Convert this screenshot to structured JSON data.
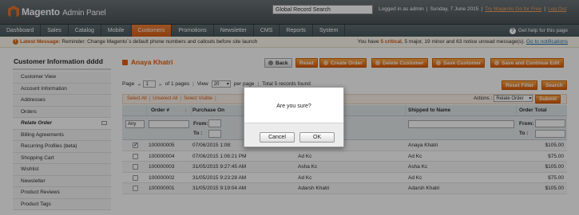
{
  "header": {
    "logo_text": "Magento",
    "logo_sub": "Admin Panel",
    "search_value": "Global Record Search",
    "logged_in": "Logged in as admin",
    "date": "Sunday, 7 June 2015",
    "try_link": "Try Magento Go for Free",
    "logout": "Log Out"
  },
  "nav": {
    "items": [
      "Dashboard",
      "Sales",
      "Catalog",
      "Mobile",
      "Customers",
      "Promotions",
      "Newsletter",
      "CMS",
      "Reports",
      "System"
    ],
    "help": "Get help for this page"
  },
  "message": {
    "label": "Latest Message:",
    "text": "Reminder: Change Magento`s default phone numbers and callouts before site launch",
    "right_prefix": "You have",
    "critical": "5 critical",
    "rest": ", 5 major, 19 minor and 63 notice unread message(s).",
    "link": "Go to notifications"
  },
  "sidebar": {
    "title": "Customer Information dddd",
    "items": [
      "Customer View",
      "Account Information",
      "Addresses",
      "Orders",
      "Relate Order",
      "Billing Agreements",
      "Recurring Profiles (beta)",
      "Shopping Cart",
      "Wishlist",
      "Newsletter",
      "Product Reviews",
      "Product Tags"
    ]
  },
  "main": {
    "title": "Anaya Khatri",
    "buttons": {
      "back": "Back",
      "reset": "Reset",
      "create_order": "Create Order",
      "delete_customer": "Delete Customer",
      "save_customer": "Save Customer",
      "save_continue": "Save and Continue Edit"
    }
  },
  "pager": {
    "page_label": "Page",
    "page_value": "1",
    "of_pages": "of 1 pages",
    "view_label": "View",
    "view_value": "20",
    "per_page": "per page",
    "total": "Total 5 records found",
    "reset_filter": "Reset Filter",
    "search": "Search"
  },
  "mass": {
    "select_all": "Select All",
    "unselect_all": "Unselect All",
    "select_visible": "Select Visible",
    "actions_label": "Actions",
    "actions_value": "Relate Order",
    "submit": "Submit"
  },
  "grid": {
    "headers": {
      "order": "Order #",
      "purchase": "Purchase On",
      "shipped": "Shipped to Name",
      "total": "Order Total"
    },
    "filter": {
      "any": "Any",
      "from": "From:",
      "to": "To :"
    },
    "rows": [
      {
        "checked": true,
        "order": "100000005",
        "purchase": "07/06/2015 1:08:",
        "bill": "",
        "ship": "Anaya Khatri",
        "total": "$105.00"
      },
      {
        "checked": false,
        "order": "100000004",
        "purchase": "07/06/2015 1:06:21 PM",
        "bill": "Ad Kc",
        "ship": "Ad Kc",
        "total": "$75.00"
      },
      {
        "checked": false,
        "order": "100000003",
        "purchase": "31/05/2015 9:27:45 AM",
        "bill": "Asha Kc",
        "ship": "Asha Kc",
        "total": "$105.00"
      },
      {
        "checked": false,
        "order": "100000002",
        "purchase": "31/05/2015 9:23:28 AM",
        "bill": "Ad Kc",
        "ship": "Ad Kc",
        "total": "$75.00"
      },
      {
        "checked": false,
        "order": "100000001",
        "purchase": "31/05/2015 9:19:04 AM",
        "bill": "Adarsh Khatri",
        "ship": "Adarsh Khatri",
        "total": "$105.00"
      }
    ]
  },
  "dialog": {
    "message": "Are you sure?",
    "cancel": "Cancel",
    "ok": "OK"
  },
  "colors": {
    "accent": "#eb5e00",
    "nav_active": "#e8702a"
  }
}
